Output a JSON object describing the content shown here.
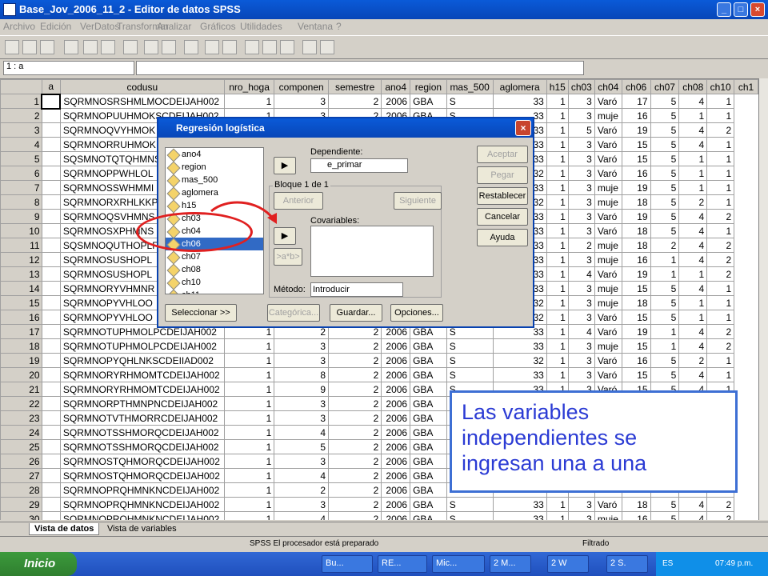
{
  "window": {
    "title": "Base_Jov_2006_11_2 - Editor de datos SPSS"
  },
  "menu": [
    "Archivo",
    "Edición",
    "Ver",
    "Datos",
    "Transformar",
    "Analizar",
    "Gráficos",
    "Utilidades",
    "Ventana",
    "?"
  ],
  "cell_ref": "1 : a",
  "columns": [
    "a",
    "codusu",
    "nro_hoga",
    "componen",
    "semestre",
    "ano4",
    "region",
    "mas_500",
    "aglomera",
    "h15",
    "ch03",
    "ch04",
    "ch06",
    "ch07",
    "ch08",
    "ch10",
    "ch1"
  ],
  "rows": [
    [
      "1",
      "",
      "SQRMNOSRSHMLMOCDEIJAH002",
      "1",
      "3",
      "2",
      "2006",
      "GBA",
      "S",
      "33",
      "1",
      "3",
      "Varó",
      "17",
      "5",
      "4",
      "1"
    ],
    [
      "2",
      "",
      "SQRMNOPUUHMOKSCDEIJAH002",
      "1",
      "3",
      "2",
      "2006",
      "GBA",
      "S",
      "33",
      "1",
      "3",
      "muje",
      "16",
      "5",
      "1",
      "1"
    ],
    [
      "3",
      "",
      "SQRMNOQVYHMOK",
      "",
      "",
      "",
      "",
      "",
      "",
      "33",
      "1",
      "5",
      "Varó",
      "19",
      "5",
      "4",
      "2"
    ],
    [
      "4",
      "",
      "SQRMNORRUHMOK",
      "",
      "",
      "",
      "",
      "",
      "",
      "33",
      "1",
      "3",
      "Varó",
      "15",
      "5",
      "4",
      "1"
    ],
    [
      "5",
      "",
      "SQSMNOTQTQHMNS",
      "",
      "",
      "",
      "",
      "",
      "",
      "33",
      "1",
      "3",
      "Varó",
      "15",
      "5",
      "1",
      "1"
    ],
    [
      "6",
      "",
      "SQRMNOPPWHLOL",
      "",
      "",
      "",
      "",
      "",
      "",
      "32",
      "1",
      "3",
      "Varó",
      "16",
      "5",
      "1",
      "1"
    ],
    [
      "7",
      "",
      "SQRMNOSSWHMMI",
      "",
      "",
      "",
      "",
      "",
      "",
      "33",
      "1",
      "3",
      "muje",
      "19",
      "5",
      "1",
      "1"
    ],
    [
      "8",
      "",
      "SQRMNORXRHLKKP",
      "",
      "",
      "",
      "",
      "",
      "",
      "32",
      "1",
      "3",
      "muje",
      "18",
      "5",
      "2",
      "1"
    ],
    [
      "9",
      "",
      "SQRMNOQSVHMNS",
      "",
      "",
      "",
      "",
      "",
      "",
      "33",
      "1",
      "3",
      "Varó",
      "19",
      "5",
      "4",
      "2"
    ],
    [
      "10",
      "",
      "SQRMNOSXPHMNS",
      "",
      "",
      "",
      "",
      "",
      "",
      "33",
      "1",
      "3",
      "Varó",
      "18",
      "5",
      "4",
      "1"
    ],
    [
      "11",
      "",
      "SQSMNOQUTHOPLF",
      "",
      "",
      "",
      "",
      "",
      "",
      "33",
      "1",
      "2",
      "muje",
      "18",
      "2",
      "4",
      "2"
    ],
    [
      "12",
      "",
      "SQRMNOSUSHOPL",
      "",
      "",
      "",
      "",
      "",
      "",
      "33",
      "1",
      "3",
      "muje",
      "16",
      "1",
      "4",
      "2"
    ],
    [
      "13",
      "",
      "SQRMNOSUSHOPL",
      "",
      "",
      "",
      "",
      "",
      "",
      "33",
      "1",
      "4",
      "Varó",
      "19",
      "1",
      "1",
      "2"
    ],
    [
      "14",
      "",
      "SQRMNORYVHMNR",
      "",
      "",
      "",
      "",
      "",
      "",
      "33",
      "1",
      "3",
      "muje",
      "15",
      "5",
      "4",
      "1"
    ],
    [
      "15",
      "",
      "SQRMNOPYVHLOO",
      "",
      "",
      "",
      "",
      "",
      "",
      "32",
      "1",
      "3",
      "muje",
      "18",
      "5",
      "1",
      "1"
    ],
    [
      "16",
      "",
      "SQRMNOPYVHLOO",
      "",
      "",
      "",
      "",
      "",
      "",
      "32",
      "1",
      "3",
      "Varó",
      "15",
      "5",
      "1",
      "1"
    ],
    [
      "17",
      "",
      "SQRMNOTUPHMOLPCDEIJAH002",
      "1",
      "2",
      "2",
      "2006",
      "GBA",
      "S",
      "33",
      "1",
      "4",
      "Varó",
      "19",
      "1",
      "4",
      "2"
    ],
    [
      "18",
      "",
      "SQRMNOTUPHMOLPCDEIJAH002",
      "1",
      "3",
      "2",
      "2006",
      "GBA",
      "S",
      "33",
      "1",
      "3",
      "muje",
      "15",
      "1",
      "4",
      "2"
    ],
    [
      "19",
      "",
      "SQRMNOPYQHLNKSCDEIIAD002",
      "1",
      "3",
      "2",
      "2006",
      "GBA",
      "S",
      "32",
      "1",
      "3",
      "Varó",
      "16",
      "5",
      "2",
      "1"
    ],
    [
      "20",
      "",
      "SQRMNORYRHMOMTCDEIJAH002",
      "1",
      "8",
      "2",
      "2006",
      "GBA",
      "S",
      "33",
      "1",
      "3",
      "Varó",
      "15",
      "5",
      "4",
      "1"
    ],
    [
      "21",
      "",
      "SQRMNORYRHMOMTCDEIJAH002",
      "1",
      "9",
      "2",
      "2006",
      "GBA",
      "S",
      "33",
      "1",
      "3",
      "Varó",
      "15",
      "5",
      "4",
      "1"
    ],
    [
      "22",
      "",
      "SQRMNORPTHMNPNCDEIJAH002",
      "1",
      "3",
      "2",
      "2006",
      "GBA",
      "",
      "",
      "",
      "",
      "",
      "",
      "",
      "",
      ""
    ],
    [
      "23",
      "",
      "SQRMNOTVTHMORRCDEIJAH002",
      "1",
      "3",
      "2",
      "2006",
      "GBA",
      "",
      "",
      "",
      "",
      "",
      "",
      "",
      "",
      ""
    ],
    [
      "24",
      "",
      "SQRMNOTSSHMORQCDEIJAH002",
      "1",
      "4",
      "2",
      "2006",
      "GBA",
      "",
      "",
      "",
      "",
      "",
      "",
      "",
      "",
      ""
    ],
    [
      "25",
      "",
      "SQRMNOTSSHMORQCDEIJAH002",
      "1",
      "5",
      "2",
      "2006",
      "GBA",
      "",
      "",
      "",
      "",
      "",
      "",
      "",
      "",
      ""
    ],
    [
      "26",
      "",
      "SQRMNOSTQHMORQCDEIJAH002",
      "1",
      "3",
      "2",
      "2006",
      "GBA",
      "",
      "",
      "",
      "",
      "",
      "",
      "",
      "",
      ""
    ],
    [
      "27",
      "",
      "SQRMNOSTQHMORQCDEIJAH002",
      "1",
      "4",
      "2",
      "2006",
      "GBA",
      "",
      "",
      "",
      "",
      "",
      "",
      "",
      "",
      ""
    ],
    [
      "28",
      "",
      "SQRMNOPRQHMNKNCDEIJAH002",
      "1",
      "2",
      "2",
      "2006",
      "GBA",
      "",
      "",
      "",
      "",
      "",
      "",
      "",
      "",
      ""
    ],
    [
      "29",
      "",
      "SQRMNOPRQHMNKNCDEIJAH002",
      "1",
      "3",
      "2",
      "2006",
      "GBA",
      "S",
      "33",
      "1",
      "3",
      "Varó",
      "18",
      "5",
      "4",
      "2"
    ],
    [
      "30",
      "",
      "SQRMNOPRQHMNKNCDEIJAH002",
      "1",
      "4",
      "2",
      "2006",
      "GBA",
      "S",
      "33",
      "1",
      "3",
      "muje",
      "16",
      "5",
      "4",
      "2"
    ]
  ],
  "tabs": {
    "data": "Vista de datos",
    "vars": "Vista de variables"
  },
  "status": {
    "processor": "SPSS El procesador está preparado",
    "filter": "Filtrado"
  },
  "dialog": {
    "title": "Regresión logística",
    "variables": [
      "ano4",
      "region",
      "mas_500",
      "aglomera",
      "h15",
      "ch03",
      "ch04",
      "ch06",
      "ch07",
      "ch08",
      "ch10",
      "ch11"
    ],
    "selected_variable": "ch06",
    "dependent_label": "Dependiente:",
    "dependent_value": "e_primar",
    "block_label": "Bloque 1 de 1",
    "prev_btn": "Anterior",
    "next_btn": "Siguiente",
    "covariates_label": "Covariables:",
    "interaction_btn": ">a*b>",
    "method_label": "Método:",
    "method_value": "Introducir",
    "select_btn": "Seleccionar >>",
    "categorical_btn": "Categórica...",
    "save_btn": "Guardar...",
    "options_btn": "Opciones...",
    "accept_btn": "Aceptar",
    "paste_btn": "Pegar",
    "reset_btn": "Restablecer",
    "cancel_btn": "Cancelar",
    "help_btn": "Ayuda"
  },
  "callout": "Las variables independientes se ingresan una a una",
  "taskbar": {
    "start": "Inicio",
    "tasks": [
      "Bu...",
      "RE...",
      "Mic...",
      "2 M...",
      "2 W",
      "2 S."
    ],
    "lang": "ES",
    "time": "07:49 p.m."
  }
}
